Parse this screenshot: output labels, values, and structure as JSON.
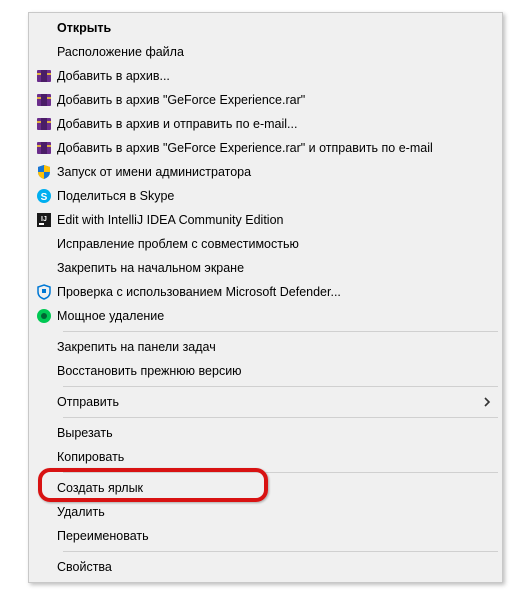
{
  "menu": {
    "open": "Открыть",
    "open_location": "Расположение файла",
    "add_archive": "Добавить в архив...",
    "add_archive_named": "Добавить в архив \"GeForce Experience.rar\"",
    "add_email": "Добавить в архив и отправить по e-mail...",
    "add_named_email": "Добавить в архив \"GeForce Experience.rar\" и отправить по e-mail",
    "run_admin": "Запуск от имени администратора",
    "share_skype": "Поделиться в Skype",
    "edit_intellij": "Edit with IntelliJ IDEA Community Edition",
    "troubleshoot": "Исправление проблем с совместимостью",
    "pin_start": "Закрепить на начальном экране",
    "defender_scan": "Проверка с использованием Microsoft Defender...",
    "power_delete": "Мощное удаление",
    "pin_taskbar": "Закрепить на панели задач",
    "restore_prev": "Восстановить прежнюю версию",
    "send_to": "Отправить",
    "cut": "Вырезать",
    "copy": "Копировать",
    "create_shortcut": "Создать ярлык",
    "delete": "Удалить",
    "rename": "Переименовать",
    "properties": "Свойства"
  },
  "colors": {
    "winrar_bg": "#6b2d8c",
    "winrar_bar": "#e0b040",
    "shield_blue": "#1976d2",
    "shield_yellow": "#ffc107",
    "skype_blue": "#00aff0",
    "intellij_bg": "#1a1a1a",
    "defender_blue": "#0078d4",
    "iobit_green": "#00c853",
    "highlight": "#d81212"
  }
}
